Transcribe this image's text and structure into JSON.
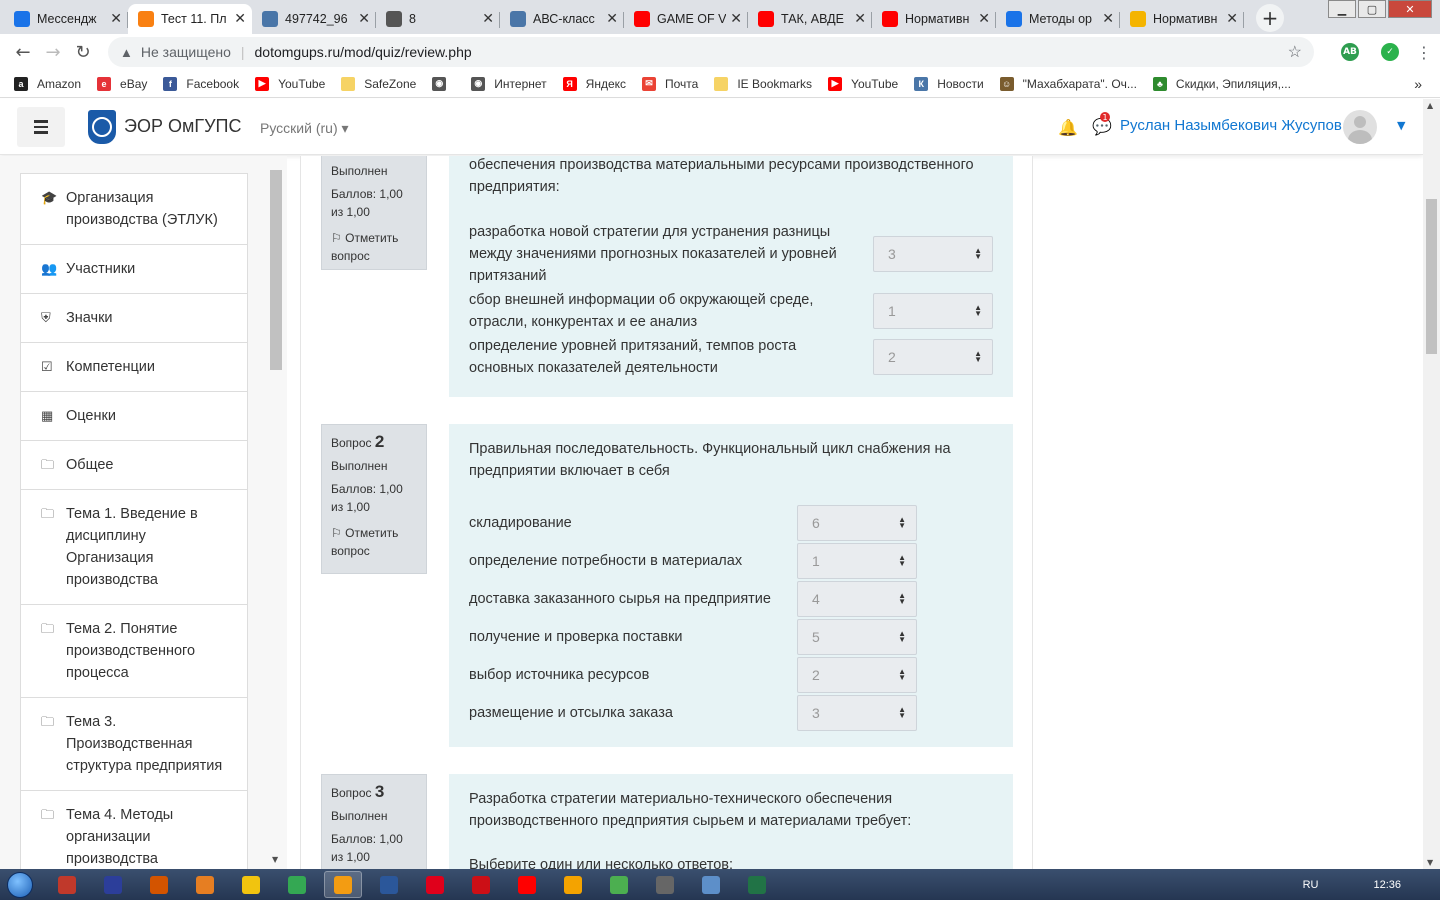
{
  "browser": {
    "tabs": [
      {
        "title": "Мессендж",
        "icon_color": "#1a73e8",
        "icon": "chat-icon"
      },
      {
        "title": "Тест 11. Пл",
        "icon_color": "#f98012",
        "icon": "moodle-icon",
        "active": true
      },
      {
        "title": "497742_96",
        "icon_color": "#4a76a8",
        "icon": "vk-icon"
      },
      {
        "title": "8",
        "icon_color": "#555555",
        "icon": "globe-icon"
      },
      {
        "title": "АВС-класс",
        "icon_color": "#4a76a8",
        "icon": "vk-icon"
      },
      {
        "title": "GAME OF V",
        "icon_color": "#ff0000",
        "icon": "youtube-icon"
      },
      {
        "title": "ТАК, АВДЕ",
        "icon_color": "#ff0000",
        "icon": "youtube-icon"
      },
      {
        "title": "Нормативн",
        "icon_color": "#ff0000",
        "icon": "yandex-icon"
      },
      {
        "title": "Методы ор",
        "icon_color": "#1a73e8",
        "icon": "page-icon"
      },
      {
        "title": "Нормативн",
        "icon_color": "#f4b400",
        "icon": "image-icon"
      }
    ],
    "new_tab": "+",
    "not_secure": "Не защищено",
    "url": "dotomgups.ru/mod/quiz/review.php",
    "bookmarks": [
      {
        "label": "Amazon",
        "color": "#222222",
        "icon": "amazon-icon",
        "glyph": "a"
      },
      {
        "label": "eBay",
        "color": "#e53238",
        "icon": "ebay-icon",
        "glyph": "e"
      },
      {
        "label": "Facebook",
        "color": "#3b5998",
        "icon": "facebook-icon",
        "glyph": "f"
      },
      {
        "label": "YouTube",
        "color": "#ff0000",
        "icon": "youtube-icon",
        "glyph": "▶"
      },
      {
        "label": "SafeZone",
        "color": "#f6d365",
        "icon": "folder-icon",
        "glyph": ""
      },
      {
        "label": "",
        "color": "#555555",
        "icon": "globe-icon",
        "glyph": "◉"
      },
      {
        "label": "Интернет",
        "color": "#555555",
        "icon": "globe-icon",
        "glyph": "◉"
      },
      {
        "label": "Яндекс",
        "color": "#ff0000",
        "icon": "yandex-icon",
        "glyph": "Я"
      },
      {
        "label": "Почта",
        "color": "#ea4335",
        "icon": "mail-icon",
        "glyph": "✉"
      },
      {
        "label": "IE Bookmarks",
        "color": "#f6d365",
        "icon": "folder-icon",
        "glyph": ""
      },
      {
        "label": "YouTube",
        "color": "#ff0000",
        "icon": "youtube-icon",
        "glyph": "▶"
      },
      {
        "label": "Новости",
        "color": "#4a76a8",
        "icon": "vk-icon",
        "glyph": "К"
      },
      {
        "label": "\"Махабхарата\". Оч...",
        "color": "#7a5c2e",
        "icon": "person-icon",
        "glyph": "☺"
      },
      {
        "label": "Скидки, Эпиляция,...",
        "color": "#2e8b2e",
        "icon": "cat-icon",
        "glyph": "♣"
      }
    ],
    "bookmarks_more": "»"
  },
  "site": {
    "name": "ЭОР ОмГУПС",
    "language": "Русский ‎(ru)‎",
    "message_count": "1",
    "user_name": "Руслан Назымбекович Жусупов"
  },
  "sidebar": {
    "items": [
      {
        "label": "Организация производства (ЭТЛУК)",
        "icon": "graduation-cap-icon",
        "glyph": "🎓"
      },
      {
        "label": "Участники",
        "icon": "users-icon",
        "glyph": "👥"
      },
      {
        "label": "Значки",
        "icon": "shield-icon",
        "glyph": "⛨"
      },
      {
        "label": "Компетенции",
        "icon": "checkbox-icon",
        "glyph": "☑"
      },
      {
        "label": "Оценки",
        "icon": "table-icon",
        "glyph": "▦"
      },
      {
        "label": "Общее",
        "icon": "folder-icon",
        "glyph": "🗀"
      },
      {
        "label": "Тема 1. Введение в дисциплину Организация производства",
        "icon": "folder-icon",
        "glyph": "🗀"
      },
      {
        "label": "Тема 2. Понятие производственного процесса",
        "icon": "folder-icon",
        "glyph": "🗀"
      },
      {
        "label": "Тема 3. Производственная структура предприятия",
        "icon": "folder-icon",
        "glyph": "🗀"
      },
      {
        "label": "Тема 4. Методы организации производства",
        "icon": "folder-icon",
        "glyph": "🗀"
      }
    ]
  },
  "questions": [
    {
      "number_label": "",
      "number": "",
      "state": "Выполнен",
      "grade": "Баллов: 1,00 из 1,00",
      "flag": "Отметить вопрос",
      "text": "обеспечения производства материальными ресурсами производственного предприятия:",
      "rows": [
        {
          "text": "разработка новой стратегии для устранения разницы между значениями прогнозных показателей и уровней притязаний",
          "value": "3"
        },
        {
          "text": "сбор внешней информации об окружающей среде, отрасли, конкурентах и ее анализ",
          "value": "1"
        },
        {
          "text": "определение уровней притязаний, темпов роста основных показателей деятельности",
          "value": "2"
        }
      ]
    },
    {
      "number_label": "Вопрос",
      "number": "2",
      "state": "Выполнен",
      "grade": "Баллов: 1,00 из 1,00",
      "flag": "Отметить вопрос",
      "text": "Правильная последовательность. Функциональный цикл снабжения на предприятии включает в себя",
      "rows": [
        {
          "text": "складирование",
          "value": "6"
        },
        {
          "text": "определение потребности в материалах",
          "value": "1"
        },
        {
          "text": "доставка заказанного сырья на предприятие",
          "value": "4"
        },
        {
          "text": "получение и проверка поставки",
          "value": "5"
        },
        {
          "text": "выбор источника ресурсов",
          "value": "2"
        },
        {
          "text": "размещение и отсылка заказа",
          "value": "3"
        }
      ]
    },
    {
      "number_label": "Вопрос",
      "number": "3",
      "state": "Выполнен",
      "grade": "Баллов: 1,00 из 1,00",
      "flag": "",
      "text": "Разработка стратегии материально-технического обеспечения производственного предприятия сырьем и материалами требует:",
      "prompt": "Выберите один или несколько ответов:",
      "rows": []
    }
  ],
  "taskbar": {
    "language": "RU",
    "clock": "12:36",
    "apps": [
      {
        "icon": "app-icon",
        "color": "#c0392b"
      },
      {
        "icon": "save-icon",
        "color": "#2c3e9a"
      },
      {
        "icon": "app-icon",
        "color": "#d35400"
      },
      {
        "icon": "settings-icon",
        "color": "#e67e22"
      },
      {
        "icon": "folder-icon",
        "color": "#f1c40f"
      },
      {
        "icon": "chrome-icon",
        "color": "#34a853"
      },
      {
        "icon": "settings-icon",
        "color": "#f39c12",
        "active": true
      },
      {
        "icon": "word-icon",
        "color": "#2b579a"
      },
      {
        "icon": "opera-icon",
        "color": "#e0001b"
      },
      {
        "icon": "opera-icon",
        "color": "#cc0f16"
      },
      {
        "icon": "yandex-icon",
        "color": "#ff0000"
      },
      {
        "icon": "app-icon",
        "color": "#f4a300"
      },
      {
        "icon": "torrent-icon",
        "color": "#4caf50"
      },
      {
        "icon": "word-icon",
        "color": "#666666"
      },
      {
        "icon": "window-icon",
        "color": "#5d8fc9"
      },
      {
        "icon": "excel-icon",
        "color": "#217346"
      }
    ]
  }
}
